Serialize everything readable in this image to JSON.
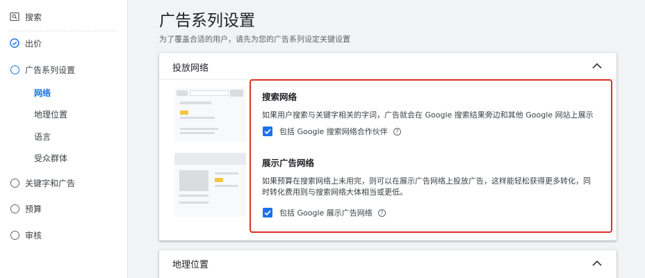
{
  "sidebar": {
    "items": [
      {
        "label": "搜索",
        "icon": "search-box-icon"
      },
      {
        "label": "出价",
        "icon": "check-circle-icon"
      },
      {
        "label": "广告系列设置",
        "icon": "circle-icon"
      },
      {
        "label": "关键字和广告",
        "icon": "circle-icon"
      },
      {
        "label": "预算",
        "icon": "circle-icon"
      },
      {
        "label": "审核",
        "icon": "circle-icon"
      }
    ],
    "sub_items": [
      "网络",
      "地理位置",
      "语言",
      "受众群体"
    ]
  },
  "page": {
    "title": "广告系列设置",
    "subtitle": "为了覆盖合适的用户，请先为您的广告系列设定关键设置"
  },
  "networks_card": {
    "header": "投放网络",
    "search_network": {
      "title": "搜索网络",
      "description": "如果用户搜索与关键字相关的字词，广告就会在 Google 搜索结果旁边和其他 Google 网站上展示",
      "checkbox_label": "包括 Google 搜索网络合作伙伴",
      "checked": true
    },
    "display_network": {
      "title": "展示广告网络",
      "description_line1": "如果预算在搜索网络上未用完，则可以在展示广告网络上投放广告，这样能轻松获得更多转化，同",
      "description_line2": "时转化费用则与搜索网络大体相当或更低。",
      "checkbox_label": "包括 Google 展示广告网络",
      "checked": true
    }
  },
  "location_card": {
    "header": "地理位置"
  },
  "colors": {
    "accent": "#1a73e8",
    "highlight_border": "#d93025",
    "illustration_yellow": "#f4c542"
  }
}
